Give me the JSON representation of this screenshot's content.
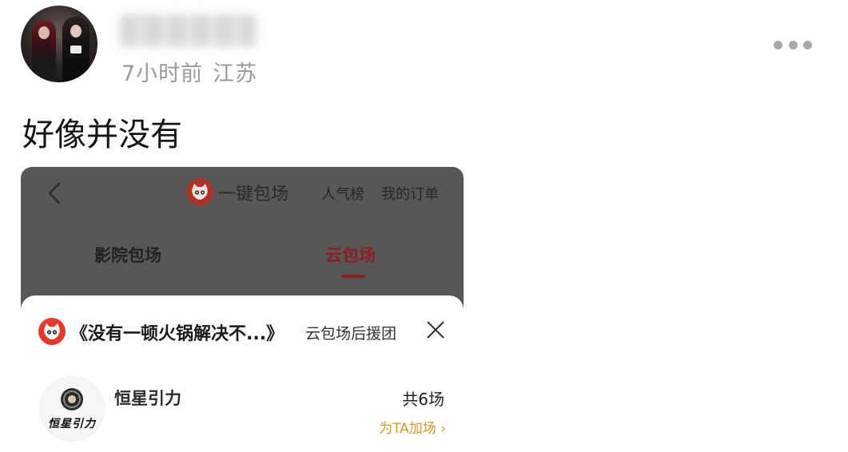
{
  "post": {
    "time": "7小时前",
    "location": "江苏",
    "text": "好像并没有"
  },
  "icons": {
    "more": "more-horizontal-icon",
    "back": "chevron-left-icon",
    "brand": "cat-logo-icon",
    "close": "close-icon"
  },
  "embedded": {
    "header": {
      "title": "一键包场",
      "links": [
        "人气榜",
        "我的订单"
      ]
    },
    "tabs": [
      {
        "label": "影院包场",
        "active": false
      },
      {
        "label": "云包场",
        "active": true
      }
    ],
    "sheet": {
      "title": "《没有一顿火锅解决不...》",
      "subtitle": "云包场后援团",
      "item": {
        "logo_text": "恒星引力",
        "name": "恒星引力",
        "count": "共6场",
        "action": "为TA加场 ›"
      }
    }
  },
  "colors": {
    "accent_red": "#8c1f22",
    "brand_red": "#e23a2e",
    "link_gold": "#d29b2b",
    "meta_gray": "#9b9b9b"
  }
}
